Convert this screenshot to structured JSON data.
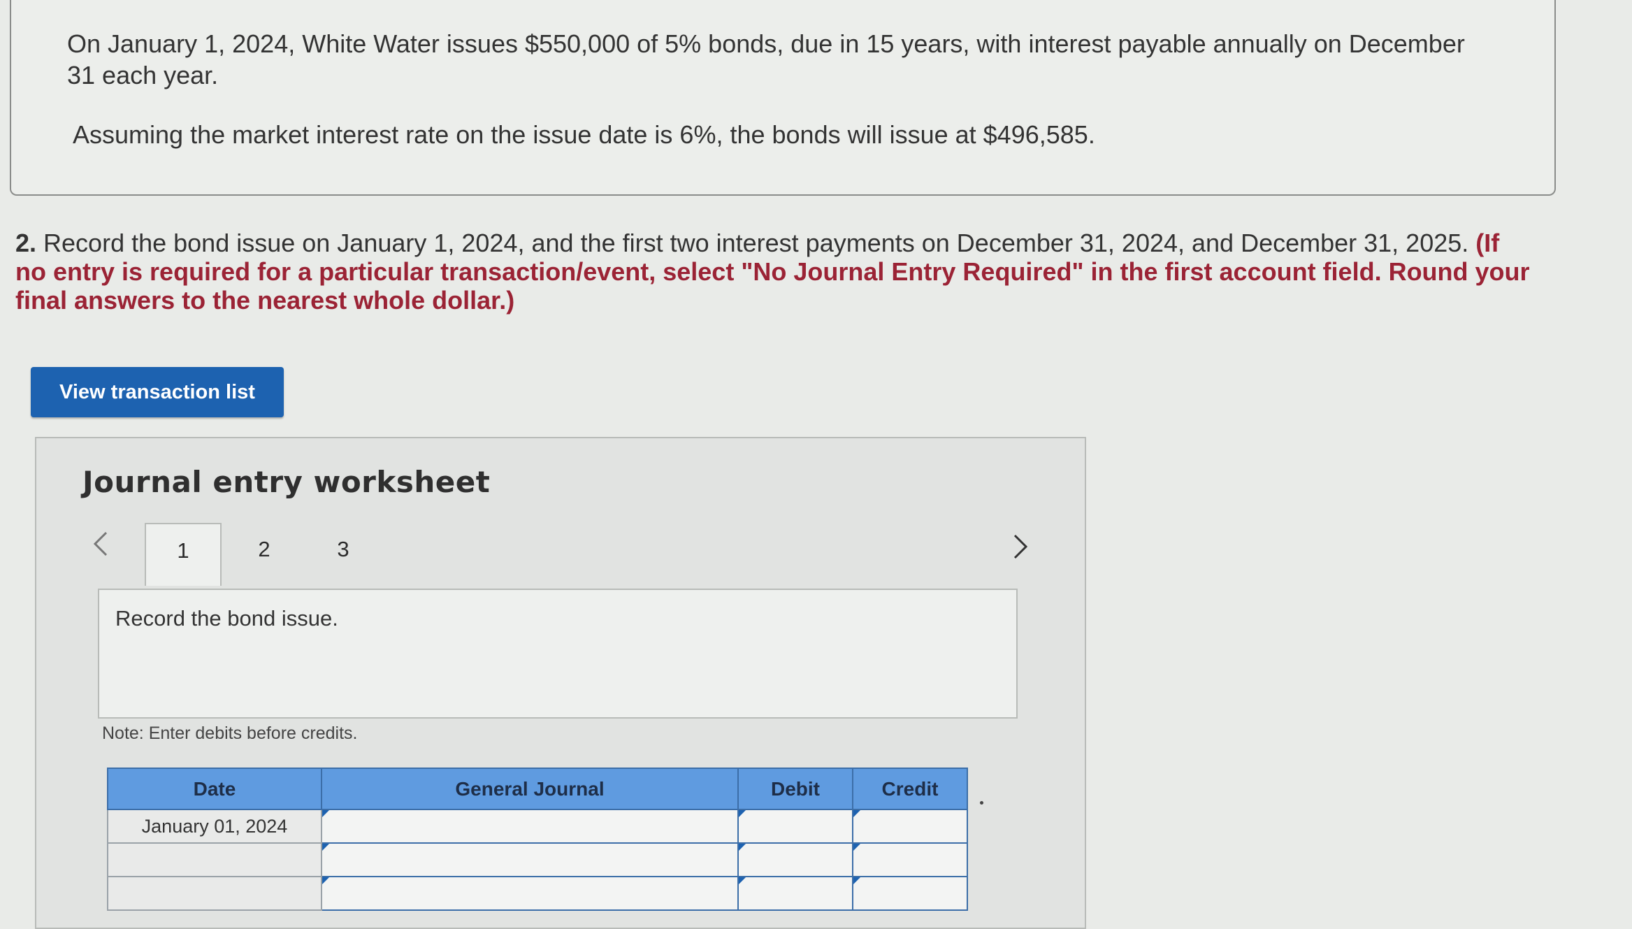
{
  "problem": {
    "line1": "On January 1, 2024, White Water issues $550,000 of 5% bonds, due in 15 years, with interest payable annually on December 31 each year.",
    "line2": "Assuming the market interest rate on the issue date is 6%, the bonds will issue at $496,585."
  },
  "question": {
    "number": "2.",
    "text": " Record the bond issue on January 1, 2024, and the first two interest payments on December 31, 2024, and December 31, 2025. ",
    "instruction": "(If no entry is required for a particular transaction/event, select \"No Journal Entry Required\" in the first account field. Round your final answers to the nearest whole dollar.)"
  },
  "view_button": "View transaction list",
  "worksheet": {
    "title": "Journal entry worksheet",
    "tabs": [
      "1",
      "2",
      "3"
    ],
    "active_tab": 0,
    "prompt": "Record the bond issue.",
    "note": "Note: Enter debits before credits.",
    "columns": [
      "Date",
      "General Journal",
      "Debit",
      "Credit"
    ],
    "rows": [
      {
        "date": "January 01, 2024",
        "account": "",
        "debit": "",
        "credit": ""
      },
      {
        "date": "",
        "account": "",
        "debit": "",
        "credit": ""
      },
      {
        "date": "",
        "account": "",
        "debit": "",
        "credit": ""
      }
    ]
  },
  "icons": {
    "prev": "chevron-left-icon",
    "next": "chevron-right-icon"
  },
  "colors": {
    "button": "#1d62b0",
    "header": "#5f9be0",
    "instruction": "#9b2335"
  }
}
